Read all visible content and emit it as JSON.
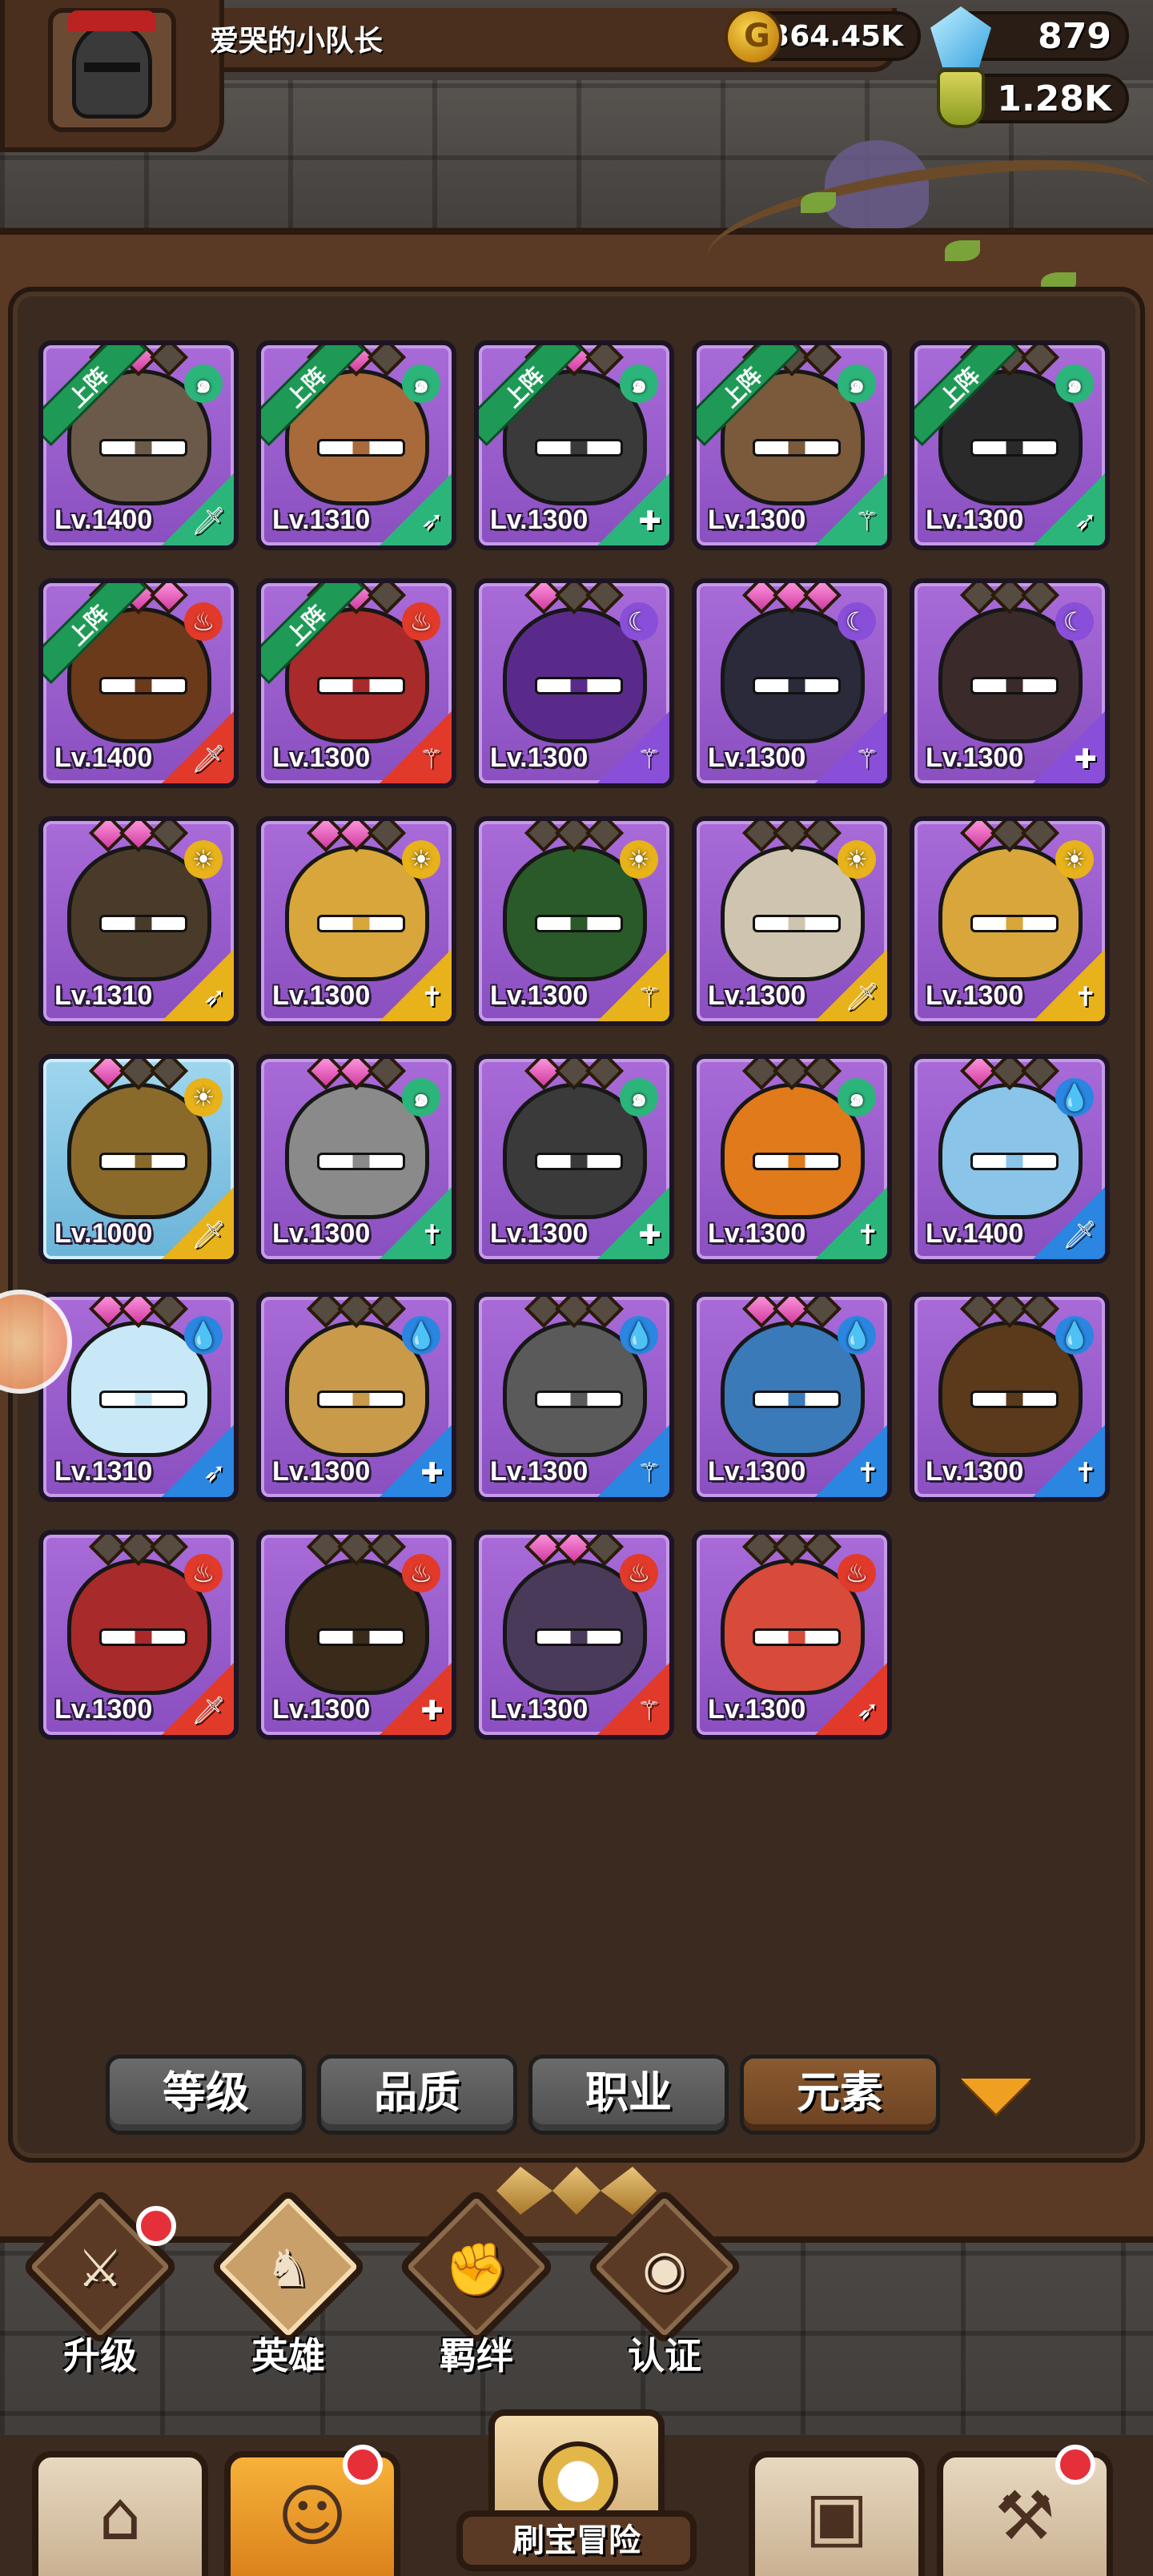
{
  "player": {
    "name": "爱哭的小队长"
  },
  "resources": {
    "gold": "364.45K",
    "gems": "879",
    "potions": "1.28K"
  },
  "colors": {
    "element_wind": "#2cb57a",
    "element_fire": "#e23a2a",
    "element_dark": "#8a4fd8",
    "element_light": "#e8b21a",
    "element_water": "#2a86e0",
    "card_epic": "#8a4fc0",
    "card_rare": "#6ab3d8"
  },
  "heroes": [
    {
      "level": "Lv.1400",
      "deployed": true,
      "tag": "上阵",
      "element": "wind",
      "class": "sword",
      "stars": 2,
      "rarity": "epic"
    },
    {
      "level": "Lv.1310",
      "deployed": true,
      "tag": "上阵",
      "element": "wind",
      "class": "bow",
      "stars": 2,
      "rarity": "epic"
    },
    {
      "level": "Lv.1300",
      "deployed": true,
      "tag": "上阵",
      "element": "wind",
      "class": "shield",
      "stars": 2,
      "rarity": "epic"
    },
    {
      "level": "Lv.1300",
      "deployed": true,
      "tag": "上阵",
      "element": "wind",
      "class": "staff",
      "stars": 0,
      "rarity": "epic"
    },
    {
      "level": "Lv.1300",
      "deployed": true,
      "tag": "上阵",
      "element": "wind",
      "class": "bow",
      "stars": 0,
      "rarity": "epic"
    },
    {
      "level": "Lv.1400",
      "deployed": true,
      "tag": "上阵",
      "element": "fire",
      "class": "sword",
      "stars": 3,
      "rarity": "epic"
    },
    {
      "level": "Lv.1300",
      "deployed": true,
      "tag": "上阵",
      "element": "fire",
      "class": "staff",
      "stars": 2,
      "rarity": "epic"
    },
    {
      "level": "Lv.1300",
      "deployed": false,
      "tag": "",
      "element": "dark",
      "class": "staff",
      "stars": 1,
      "rarity": "epic"
    },
    {
      "level": "Lv.1300",
      "deployed": false,
      "tag": "",
      "element": "dark",
      "class": "staff",
      "stars": 3,
      "rarity": "epic"
    },
    {
      "level": "Lv.1300",
      "deployed": false,
      "tag": "",
      "element": "dark",
      "class": "shield",
      "stars": 0,
      "rarity": "epic"
    },
    {
      "level": "Lv.1310",
      "deployed": false,
      "tag": "",
      "element": "light",
      "class": "bow",
      "stars": 2,
      "rarity": "epic"
    },
    {
      "level": "Lv.1300",
      "deployed": false,
      "tag": "",
      "element": "light",
      "class": "cross",
      "stars": 2,
      "rarity": "epic"
    },
    {
      "level": "Lv.1300",
      "deployed": false,
      "tag": "",
      "element": "light",
      "class": "staff",
      "stars": 0,
      "rarity": "epic"
    },
    {
      "level": "Lv.1300",
      "deployed": false,
      "tag": "",
      "element": "light",
      "class": "sword",
      "stars": 0,
      "rarity": "epic"
    },
    {
      "level": "Lv.1300",
      "deployed": false,
      "tag": "",
      "element": "light",
      "class": "cross",
      "stars": 1,
      "rarity": "epic"
    },
    {
      "level": "Lv.1000",
      "deployed": false,
      "tag": "",
      "element": "light",
      "class": "sword",
      "stars": 1,
      "rarity": "rare"
    },
    {
      "level": "Lv.1300",
      "deployed": false,
      "tag": "",
      "element": "wind",
      "class": "cross",
      "stars": 2,
      "rarity": "epic"
    },
    {
      "level": "Lv.1300",
      "deployed": false,
      "tag": "",
      "element": "wind",
      "class": "shield",
      "stars": 1,
      "rarity": "epic"
    },
    {
      "level": "Lv.1300",
      "deployed": false,
      "tag": "",
      "element": "wind",
      "class": "cross",
      "stars": 0,
      "rarity": "epic"
    },
    {
      "level": "Lv.1400",
      "deployed": false,
      "tag": "",
      "element": "water",
      "class": "sword",
      "stars": 1,
      "rarity": "epic"
    },
    {
      "level": "Lv.1310",
      "deployed": false,
      "tag": "",
      "element": "water",
      "class": "bow",
      "stars": 2,
      "rarity": "epic"
    },
    {
      "level": "Lv.1300",
      "deployed": false,
      "tag": "",
      "element": "water",
      "class": "shield",
      "stars": 0,
      "rarity": "epic"
    },
    {
      "level": "Lv.1300",
      "deployed": false,
      "tag": "",
      "element": "water",
      "class": "staff",
      "stars": 0,
      "rarity": "epic"
    },
    {
      "level": "Lv.1300",
      "deployed": false,
      "tag": "",
      "element": "water",
      "class": "cross",
      "stars": 2,
      "rarity": "epic"
    },
    {
      "level": "Lv.1300",
      "deployed": false,
      "tag": "",
      "element": "water",
      "class": "cross",
      "stars": 0,
      "rarity": "epic"
    },
    {
      "level": "Lv.1300",
      "deployed": false,
      "tag": "",
      "element": "fire",
      "class": "sword",
      "stars": 0,
      "rarity": "epic"
    },
    {
      "level": "Lv.1300",
      "deployed": false,
      "tag": "",
      "element": "fire",
      "class": "shield",
      "stars": 0,
      "rarity": "epic"
    },
    {
      "level": "Lv.1300",
      "deployed": false,
      "tag": "",
      "element": "fire",
      "class": "staff",
      "stars": 2,
      "rarity": "epic"
    },
    {
      "level": "Lv.1300",
      "deployed": false,
      "tag": "",
      "element": "fire",
      "class": "bow",
      "stars": 0,
      "rarity": "epic"
    }
  ],
  "sort_buttons": [
    {
      "label": "等级",
      "active": false
    },
    {
      "label": "品质",
      "active": false
    },
    {
      "label": "职业",
      "active": false
    },
    {
      "label": "元素",
      "active": true
    }
  ],
  "subtabs": [
    {
      "label": "升级",
      "icon": "sword-icon",
      "badge": true
    },
    {
      "label": "英雄",
      "icon": "hero-icon",
      "badge": false,
      "active": true
    },
    {
      "label": "羁绊",
      "icon": "handshake-icon",
      "badge": false
    },
    {
      "label": "认证",
      "icon": "eye-icon",
      "badge": false
    }
  ],
  "bottom_nav": {
    "shop_icon": "shop-icon",
    "hero_icon": "hero-portrait-icon",
    "adventure_label": "刷宝冒险",
    "bag_icon": "backpack-icon",
    "forge_icon": "hammer-icon"
  }
}
